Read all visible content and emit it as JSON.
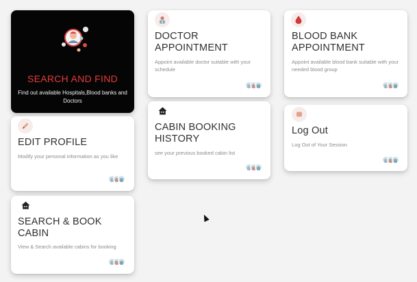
{
  "search_card": {
    "title": "SEARCH AND FIND",
    "description": "Find out available Hospitals,Blood banks and Doctors"
  },
  "cards": {
    "doctor": {
      "title": "DOCTOR APPOINTMENT",
      "description": "Appoint available doctor suitable with your schedule",
      "icon": "doctor-icon"
    },
    "blood_bank": {
      "title": "BLOOD BANK APPOINTMENT",
      "description": "Appoint available blood bank suitable with your needed blood group",
      "icon": "blood-drop-icon"
    },
    "edit_profile": {
      "title": "EDIT PROFILE",
      "description": "Modify your personal information as you like",
      "icon": "pencil-icon"
    },
    "cabin_history": {
      "title": "CABIN BOOKING HISTORY",
      "description": "see your previous booked cabin list",
      "icon": "house-icon"
    },
    "logout": {
      "title": "Log Out",
      "description": "Log Out of Your Session",
      "icon": "logout-icon"
    },
    "search_book_cabin": {
      "title": "SEARCH & BOOK CABIN",
      "description": "View & Search available cabins for booking",
      "icon": "house-icon"
    }
  },
  "colors": {
    "background": "#f3f3f4",
    "card": "#ffffff",
    "dark_card": "#050505",
    "accent_red": "#e63b3b",
    "title": "#2f2f33",
    "description": "#8b8b90"
  }
}
